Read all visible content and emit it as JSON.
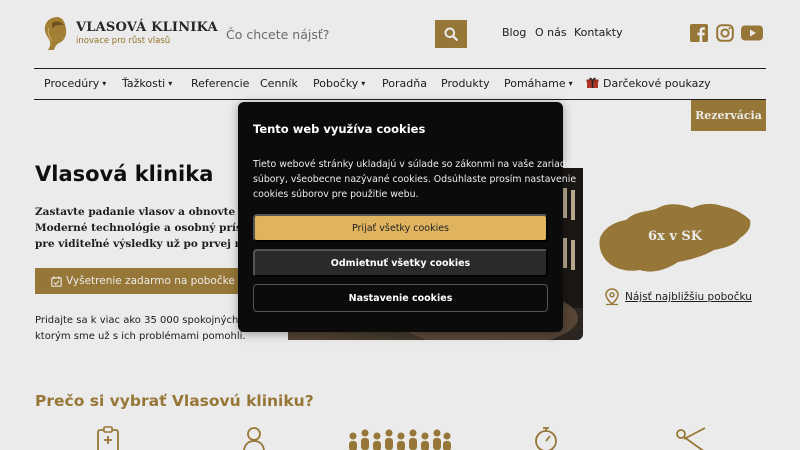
{
  "brand": {
    "name": "VLASOVÁ KLINIKA",
    "tagline": "inovace pro růst vlasů",
    "accent": "#a4823d",
    "cookie_accent": "#e0b35e"
  },
  "search": {
    "placeholder": "Čo chcete nájsť?"
  },
  "toplinks": [
    "Blog",
    "O nás",
    "Kontakty"
  ],
  "social": [
    "facebook-icon",
    "instagram-icon",
    "youtube-icon"
  ],
  "nav": {
    "items": [
      {
        "label": "Procedúry",
        "dropdown": true
      },
      {
        "label": "Ťažkosti",
        "dropdown": true
      },
      {
        "label": "Referencie",
        "dropdown": false
      },
      {
        "label": "Cenník",
        "dropdown": false
      },
      {
        "label": "Pobočky",
        "dropdown": true
      },
      {
        "label": "Poradňa",
        "dropdown": false
      },
      {
        "label": "Produkty",
        "dropdown": false
      },
      {
        "label": "Pomáhame",
        "dropdown": true
      },
      {
        "label": "Darčekové poukazy",
        "dropdown": false
      }
    ],
    "reserve_label": "Rezervácia"
  },
  "hero": {
    "title": "Vlasová klinika",
    "desc": [
      "Zastavte padanie vlasov a obnovte ich k",
      "Moderné technológie a osobný prístup",
      "pre viditeľné výsledky už po prvej návšte"
    ],
    "cta_label": "Vyšetrenie zadarmo na pobočke",
    "proof": [
      "Pridajte sa k viac ako 35 000 spokojných kl",
      "ktorým sme už s ich problémami pomohli."
    ]
  },
  "branches": {
    "map_label": "6x v SK",
    "link_label": "Nájsť najbližšiu pobočku"
  },
  "why": {
    "title": "Prečo si vybrať Vlasovú kliniku?"
  },
  "cookie": {
    "title": "Tento web využíva cookies",
    "text": [
      "Tieto webové stránky ukladajú v súlade so zákonmi na vaše zariadenie",
      "súbory, všeobecne nazývané cookies. Odsúhlaste prosím nastavenie",
      "cookies súborov pre použitie webu."
    ],
    "accept_label": "Prijať všetky cookies",
    "reject_label": "Odmietnuť všetky cookies",
    "settings_label": "Nastavenie cookies"
  }
}
